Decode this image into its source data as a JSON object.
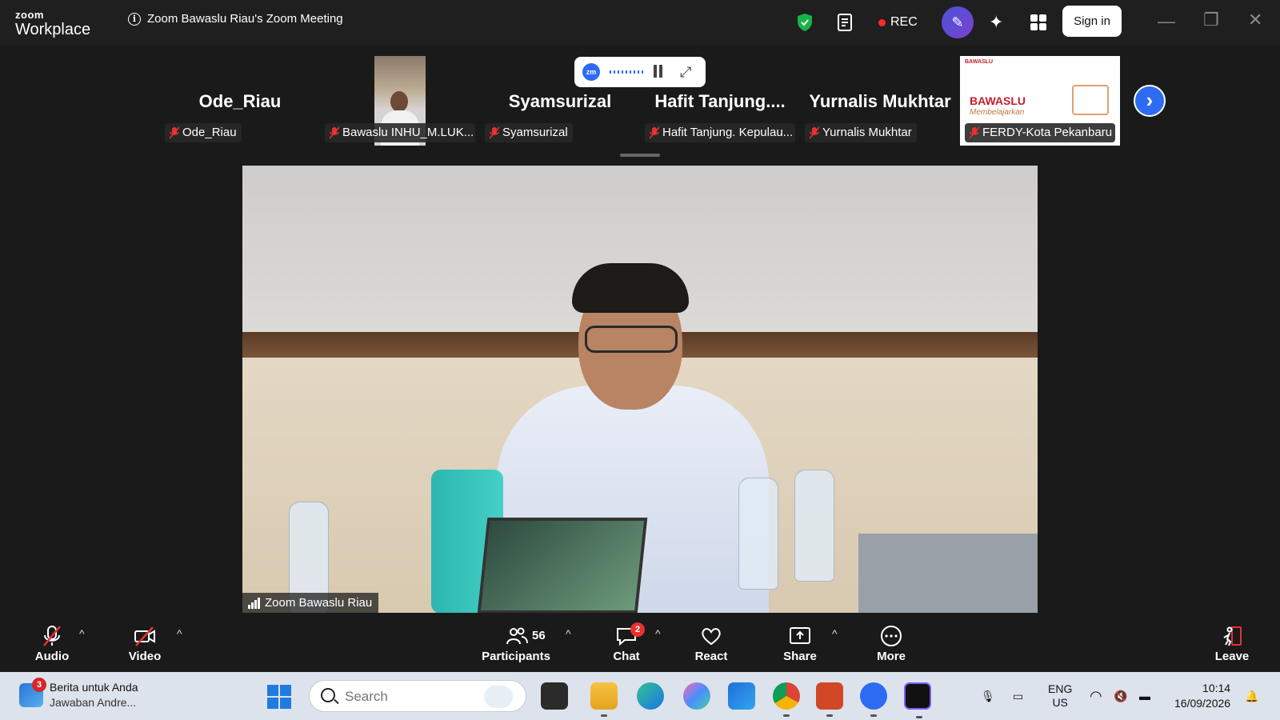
{
  "app": {
    "logo_top": "zoom",
    "logo_bottom": "Workplace",
    "meeting_title": "Zoom Bawaslu Riau's Zoom Meeting",
    "rec_label": "REC",
    "signin_label": "Sign in"
  },
  "participants_strip": [
    {
      "display": "Ode_Riau",
      "label": "Ode_Riau"
    },
    {
      "display": "",
      "label": "Bawaslu INHU_M.LUK..."
    },
    {
      "display": "Syamsurizal",
      "label": "Syamsurizal"
    },
    {
      "display": "Hafit  Tanjung....",
      "label": "Hafit Tanjung. Kepulau..."
    },
    {
      "display": "Yurnalis Mukhtar",
      "label": "Yurnalis Mukhtar"
    },
    {
      "display": "",
      "label": "FERDY-Kota Pekanbaru",
      "logo_text": "BAWASLU",
      "logo_sub": "Membelajarkan",
      "logo_header": "BAWASLU"
    }
  ],
  "floating_controls": {
    "zm_label": "zm"
  },
  "main_video": {
    "label": "Zoom Bawaslu Riau"
  },
  "toolbar": {
    "audio": "Audio",
    "video": "Video",
    "participants": "Participants",
    "participants_count": "56",
    "chat": "Chat",
    "chat_badge": "2",
    "react": "React",
    "share": "Share",
    "more": "More",
    "leave": "Leave"
  },
  "taskbar": {
    "news_title": "Berita untuk Anda",
    "news_sub": "Jawaban Andre...",
    "news_badge": "3",
    "search_placeholder": "Search",
    "lang_top": "ENG",
    "lang_bottom": "US",
    "time": "10:14",
    "date": "16/09/2026"
  },
  "colors": {
    "accent": "#2d6cf2",
    "rec": "#ff2a2a",
    "mute": "#e8312f",
    "shield": "#19b34a"
  }
}
